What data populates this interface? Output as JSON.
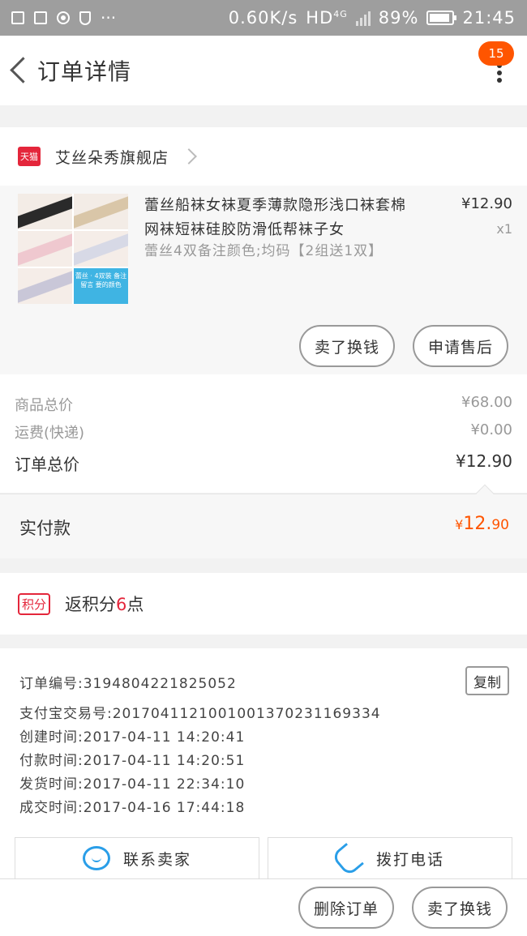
{
  "status_bar": {
    "speed": "0.60K/s",
    "network": "HD",
    "network_sub": "4G",
    "battery": "89%",
    "time": "21:45"
  },
  "header": {
    "title": "订单详情",
    "badge": "15"
  },
  "store": {
    "platform_tag": "天猫",
    "name": "艾丝朵秀旗舰店"
  },
  "product": {
    "title": "蕾丝船袜女袜夏季薄款隐形浅口袜套棉网袜短袜硅胶防滑低帮袜子女",
    "sku": "蕾丝4双备注颜色;均码【2组送1双】",
    "price": "¥12.90",
    "quantity": "x1",
    "thumb_caption": "蕾丝 · 4双装 备注留言 要的颜色",
    "sell_button": "卖了换钱",
    "aftersale_button": "申请售后"
  },
  "summary": {
    "goods_total_label": "商品总价",
    "goods_total_value": "¥68.00",
    "shipping_label": "运费(快递)",
    "shipping_value": "¥0.00",
    "order_total_label": "订单总价",
    "order_total_value": "¥12.90"
  },
  "paid": {
    "label": "实付款",
    "currency": "¥",
    "integer": "12.",
    "decimal": "90"
  },
  "points": {
    "tag": "积分",
    "prefix": "返积分",
    "num": "6",
    "suffix": "点"
  },
  "order_info": {
    "copy_button": "复制",
    "lines": [
      "订单编号:3194804221825052",
      "支付宝交易号:2017041121001001370231169334",
      "创建时间:2017-04-11 14:20:41",
      "付款时间:2017-04-11 14:20:51",
      "发货时间:2017-04-11 22:34:10",
      "成交时间:2017-04-16 17:44:18"
    ]
  },
  "contact": {
    "seller_label": "联系卖家",
    "phone_label": "拨打电话"
  },
  "bottom_bar": {
    "delete_label": "删除订单",
    "sell_label": "卖了换钱"
  },
  "colors": {
    "accent": "#ff5500",
    "tmall_red": "#e4263b",
    "icon_blue": "#2a9ee8"
  }
}
